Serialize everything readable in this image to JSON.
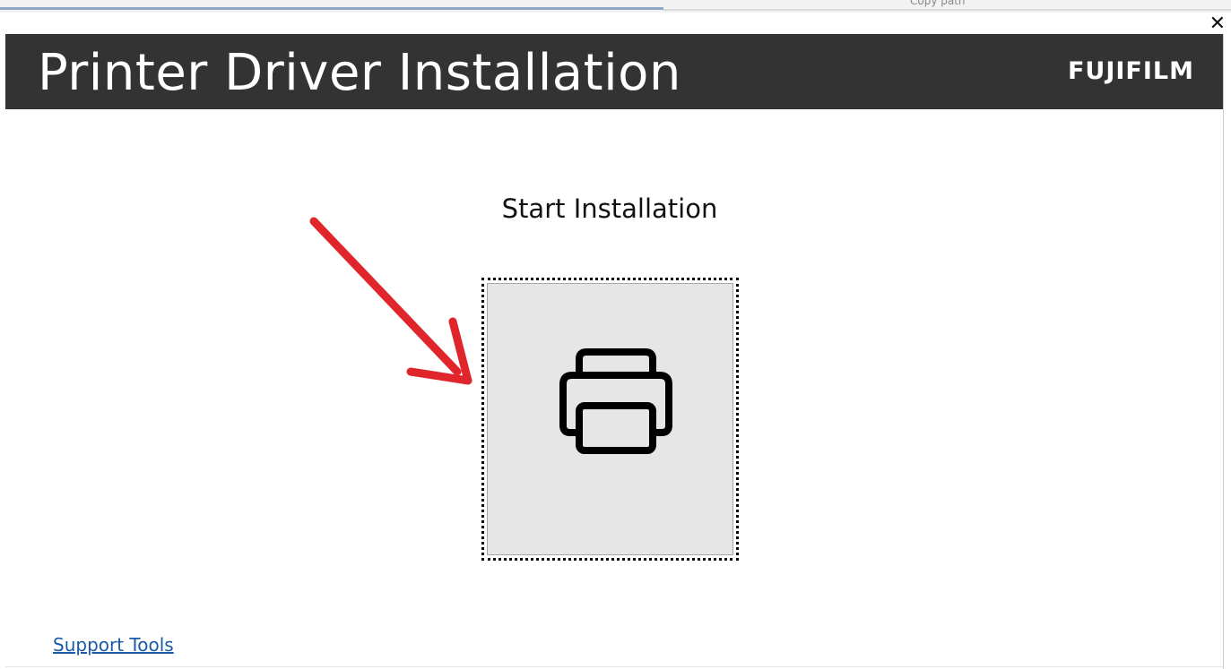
{
  "background_window": {
    "partial_text": "Copy path"
  },
  "window_controls": {
    "minimize": "_",
    "close": "✕"
  },
  "header": {
    "title": "Printer Driver Installation",
    "brand": "FUJIFILM",
    "background_color": "#333333"
  },
  "main": {
    "start_label": "Start Installation",
    "install_button_icon": "printer-icon",
    "annotation": "red-arrow-icon"
  },
  "footer": {
    "support_link": "Support Tools",
    "link_color": "#1a5aa6"
  }
}
